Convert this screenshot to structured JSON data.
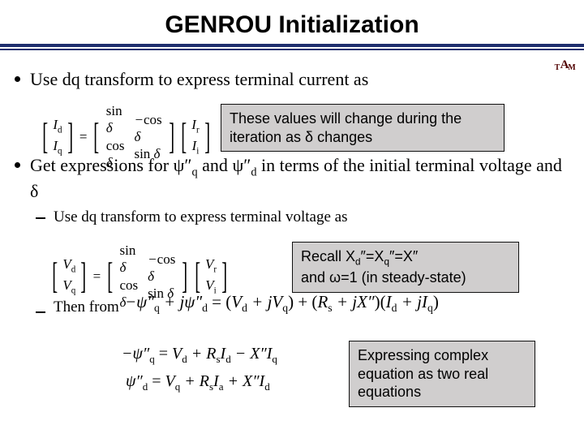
{
  "title": "GENROU Initialization",
  "logo_alt": "Texas A&M logo",
  "bullets": {
    "b1": "Use dq transform to express terminal current as",
    "b2_pre": "Get expressions for ",
    "b2_psi_q": "ψ″",
    "b2_q_sub": "q",
    "b2_mid": " and ",
    "b2_psi_d": "ψ″",
    "b2_d_sub": "d",
    "b2_post": " in terms of the initial terminal voltage and δ"
  },
  "sub": {
    "s1": "Use dq transform to express terminal voltage as",
    "s2": "Then from"
  },
  "notes": {
    "n1": "These values will change during the iteration as δ changes",
    "n2_line1": "Recall X",
    "n2_d": "d",
    "n2_mid1": "″=X",
    "n2_q": "q",
    "n2_mid2": "″=X″",
    "n2_line2": "and ω=1 (in steady-state)",
    "n3": "Expressing complex equation as two real equations"
  },
  "matrix1": {
    "lhs": [
      "I_d",
      "I_q"
    ],
    "m": [
      [
        "sin δ",
        "−cos δ"
      ],
      [
        "cos δ",
        "sin δ"
      ]
    ],
    "rhs": [
      "I_r",
      "I_i"
    ]
  },
  "matrix2": {
    "lhs": [
      "V_d",
      "V_q"
    ],
    "m": [
      [
        "sin δ",
        "−cos δ"
      ],
      [
        "cos δ",
        "sin δ"
      ]
    ],
    "rhs": [
      "V_r",
      "V_i"
    ]
  },
  "eq_long": "−ψ″_q + jψ″_d = (V_d + jV_q) + (R_s + jX″)(I_d + jI_q)",
  "eq_pair": {
    "line1": "−ψ″_q = V_d + R_s I_d − X″ I_q",
    "line2": "ψ″_d = V_q + R_s I_a + X″ I_d"
  }
}
